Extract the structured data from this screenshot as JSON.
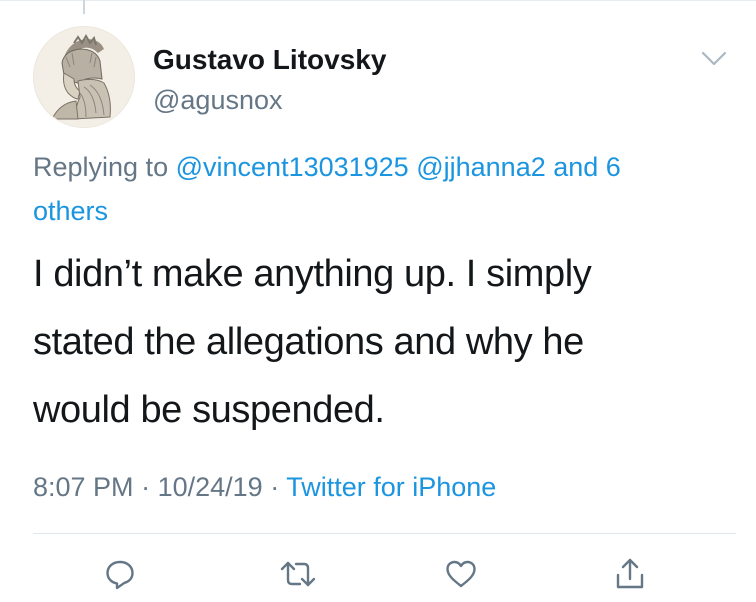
{
  "tweet": {
    "author": {
      "display_name": "Gustavo Litovsky",
      "handle": "@agusnox",
      "avatar_icon": "medieval-knight-engraving-avatar"
    },
    "reply": {
      "prefix": "Replying to",
      "mentions": [
        "@vincent13031925",
        "@jjhanna2"
      ],
      "and_text": "and 6",
      "others_text": "others"
    },
    "text_lines": [
      "I didn’t make anything up. I simply",
      "stated the allegations and why he",
      "would be suspended."
    ],
    "meta": {
      "time": "8:07 PM",
      "separator": "·",
      "date": "10/24/19",
      "source": "Twitter for iPhone"
    },
    "actions": [
      "reply-icon",
      "retweet-icon",
      "like-icon",
      "share-icon"
    ]
  },
  "colors": {
    "text": "#14171a",
    "secondary": "#657786",
    "link": "#1b95e0",
    "icon": "#657786",
    "divider": "#e1e8ed"
  }
}
